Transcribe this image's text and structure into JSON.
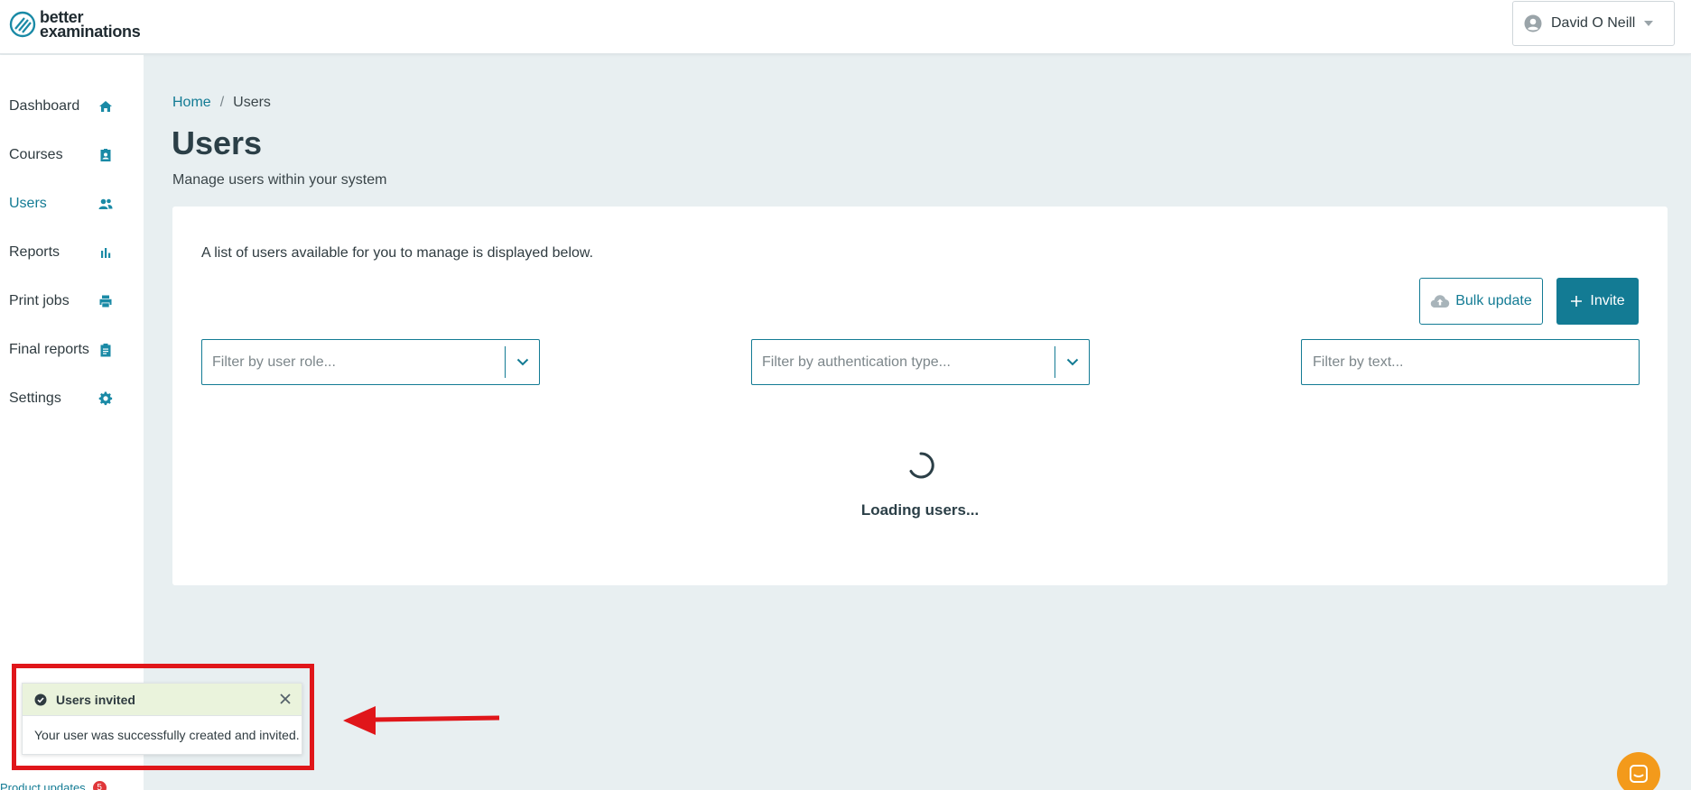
{
  "brand": {
    "line1": "better",
    "line2": "examinations"
  },
  "header": {
    "user_name": "David O Neill"
  },
  "sidebar": {
    "items": [
      {
        "label": "Dashboard",
        "icon": "home-icon"
      },
      {
        "label": "Courses",
        "icon": "badge-icon"
      },
      {
        "label": "Users",
        "icon": "users-icon",
        "active": true
      },
      {
        "label": "Reports",
        "icon": "bar-chart-icon"
      },
      {
        "label": "Print jobs",
        "icon": "printer-icon"
      },
      {
        "label": "Final reports",
        "icon": "clipboard-icon"
      },
      {
        "label": "Settings",
        "icon": "gear-icon"
      }
    ],
    "product_updates": {
      "label": "Product updates",
      "count": "5"
    }
  },
  "breadcrumb": {
    "home": "Home",
    "separator": "/",
    "current": "Users"
  },
  "page": {
    "title": "Users",
    "subtitle": "Manage users within your system",
    "description": "A list of users available for you to manage is displayed below."
  },
  "actions": {
    "bulk_update": "Bulk update",
    "invite": "Invite"
  },
  "filters": {
    "role_placeholder": "Filter by user role...",
    "auth_placeholder": "Filter by authentication type...",
    "text_placeholder": "Filter by text..."
  },
  "loading_text": "Loading users...",
  "toast": {
    "title": "Users invited",
    "message": "Your user was successfully created and invited."
  },
  "colors": {
    "accent": "#137b94",
    "background": "#e8eff1",
    "toast_header": "#eaf3dc",
    "annotation_red": "#e0161a",
    "chat_orange": "#f39a1b"
  }
}
